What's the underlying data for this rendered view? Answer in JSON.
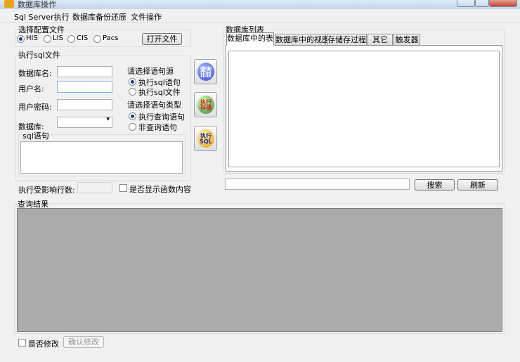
{
  "window": {
    "title": "数据库操作"
  },
  "menu": [
    "Sql Server执行",
    "数据库备份还原",
    "文件操作"
  ],
  "config": {
    "group_label": "选择配置文件",
    "options": [
      "HIS",
      "LIS",
      "CIS",
      "Pacs"
    ],
    "selected": "HIS",
    "open_file_label": "打开文件"
  },
  "exec": {
    "group_label": "执行sql文件",
    "db_name_label": "数据库名:",
    "db_name_value": "",
    "username_label": "用户名:",
    "username_value": "",
    "password_label": "用户密码:",
    "password_value": "",
    "database_label": "数据库:",
    "database_value": "",
    "source_group": "请选择语句源",
    "source_options": [
      "执行sql语句",
      "执行sql文件"
    ],
    "source_selected": "执行sql语句",
    "type_group": "请选择语句类型",
    "type_options": [
      "执行查询语句",
      "非查询语句"
    ],
    "type_selected": "执行查询语句",
    "sql_group": "sql语句",
    "sql_value": "",
    "affected_label": "执行受影响行数:",
    "affected_value": "",
    "show_func_label": "是否显示函数内容",
    "show_func_checked": false
  },
  "side_buttons": [
    {
      "label": "查询\n比较",
      "color": "#3a4fd8",
      "text_color": "#ffffff"
    },
    {
      "label": "执行\n存储",
      "color": "#2e8b3a",
      "text_color": "#d02020"
    },
    {
      "label": "执行\nSQL",
      "color": "#e8a11a",
      "text_color": "#1a2a9a"
    }
  ],
  "db_list": {
    "group_label": "数据库列表",
    "tabs": [
      "数据库中的表",
      "数据库中的视图",
      "存储存过程",
      "其它",
      "触发器"
    ],
    "active_tab": "数据库中的表",
    "search_value": "",
    "search_label": "搜索",
    "refresh_label": "刷新"
  },
  "results": {
    "group_label": "查询结果",
    "grid_color": "#ababab",
    "modify_label": "是否修改",
    "modify_checked": false,
    "confirm_label": "确认修改"
  }
}
